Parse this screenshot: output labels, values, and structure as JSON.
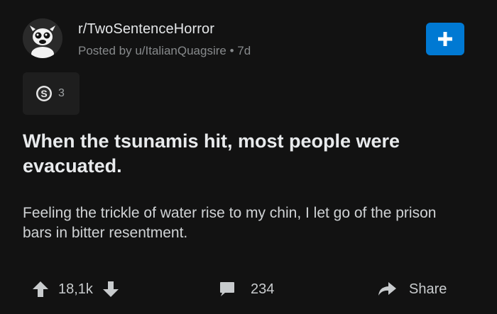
{
  "post": {
    "subreddit": "r/TwoSentenceHorror",
    "meta": "Posted by u/ItalianQuagsire • 7d",
    "award_count": "3",
    "title": "When the tsunamis hit, most people were evacuated.",
    "body": "Feeling the trickle of water rise to my chin, I let go of the prison bars in bitter resentment."
  },
  "actions": {
    "votes": "18,1k",
    "comments": "234",
    "share_label": "Share"
  },
  "icons": {
    "join": "plus-icon",
    "award": "coin-award-icon",
    "upvote": "arrow-up-icon",
    "downvote": "arrow-down-icon",
    "comments": "comment-bubble-icon",
    "share": "share-arrow-icon"
  },
  "colors": {
    "background": "#121212",
    "accent": "#0079d3",
    "text": "#d7dadc",
    "muted": "#878a8c"
  }
}
